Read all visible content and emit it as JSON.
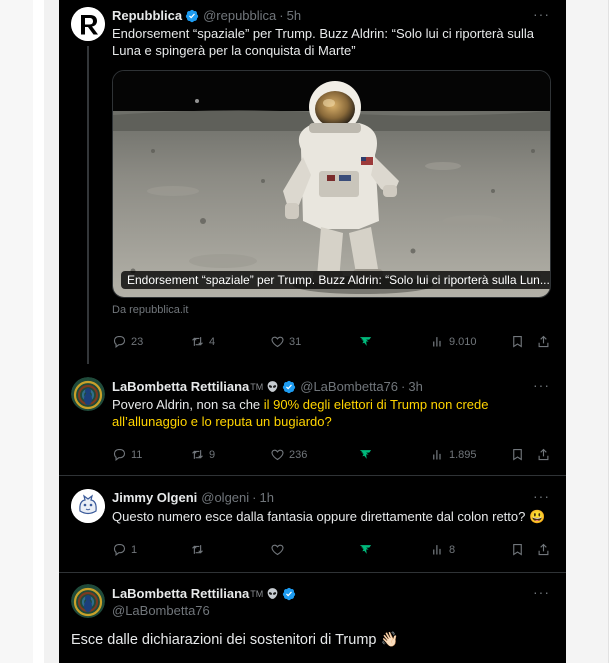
{
  "tweets": [
    {
      "name": "Repubblica",
      "handle": "@repubblica",
      "time": "5h",
      "text": "Endorsement “spaziale” per Trump. Buzz Aldrin: “Solo lui ci riporterà sulla Luna e spingerà per la conquista di Marte”",
      "media_caption": "Endorsement “spaziale” per Trump. Buzz Aldrin: “Solo lui ci riporterà sulla Lun...",
      "source": "Da repubblica.it",
      "replies": "23",
      "retweets": "4",
      "likes": "31",
      "views": "9.010"
    },
    {
      "name": "LaBombetta Rettiliana",
      "tm": "TM",
      "handle": "@LaBombetta76",
      "time": "3h",
      "text_before": "Povero Aldrin, non sa che ",
      "text_highlight_1": "il 90% degli elettori di Trump non crede",
      "text_highlight_2": "all’allunaggio e lo reputa un bugiardo?",
      "replies": "11",
      "retweets": "9",
      "likes": "236",
      "views": "1.895"
    },
    {
      "name": "Jimmy Olgeni",
      "handle": "@olgeni",
      "time": "1h",
      "text": "Questo numero esce dalla fantasia oppure direttamente dal colon retto?",
      "emoji": "😃",
      "replies": "1",
      "retweets": "",
      "likes": "",
      "views": "8"
    },
    {
      "name": "LaBombetta Rettiliana",
      "tm": "TM",
      "handle": "@LaBombetta76",
      "text": "Esce dalle dichiarazioni dei sostenitori di Trump",
      "emoji": "👋🏻"
    }
  ],
  "more_glyph": "···",
  "colors": {
    "background": "#000000",
    "text": "#e7e9ea",
    "muted": "#71767b",
    "verified": "#1d9bf0",
    "highlight": "#ffd400",
    "grok": "#00ba7c"
  }
}
